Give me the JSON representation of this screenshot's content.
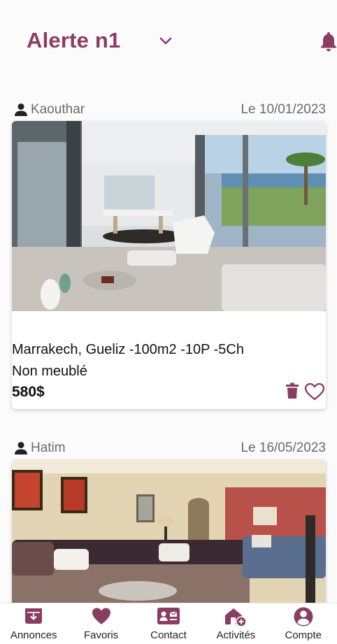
{
  "header": {
    "title": "Alerte n1"
  },
  "listings": [
    {
      "user": "Kaouthar",
      "date": "Le 10/01/2023",
      "address": "Marrakech, Gueliz -100m2 -10P -5Ch",
      "furnishing": "Non meublé",
      "price": "580$"
    },
    {
      "user": "Hatim",
      "date": "Le 16/05/2023"
    }
  ],
  "nav": {
    "items": [
      {
        "label": "Annonces",
        "icon": "inbox-download-icon"
      },
      {
        "label": "Favoris",
        "icon": "heart-icon"
      },
      {
        "label": "Contact",
        "icon": "contact-card-icon"
      },
      {
        "label": "Activités",
        "icon": "house-add-icon"
      },
      {
        "label": "Compte",
        "icon": "account-circle-icon"
      }
    ]
  },
  "colors": {
    "accent": "#8a3d62",
    "text_muted": "#6a6a6a"
  }
}
